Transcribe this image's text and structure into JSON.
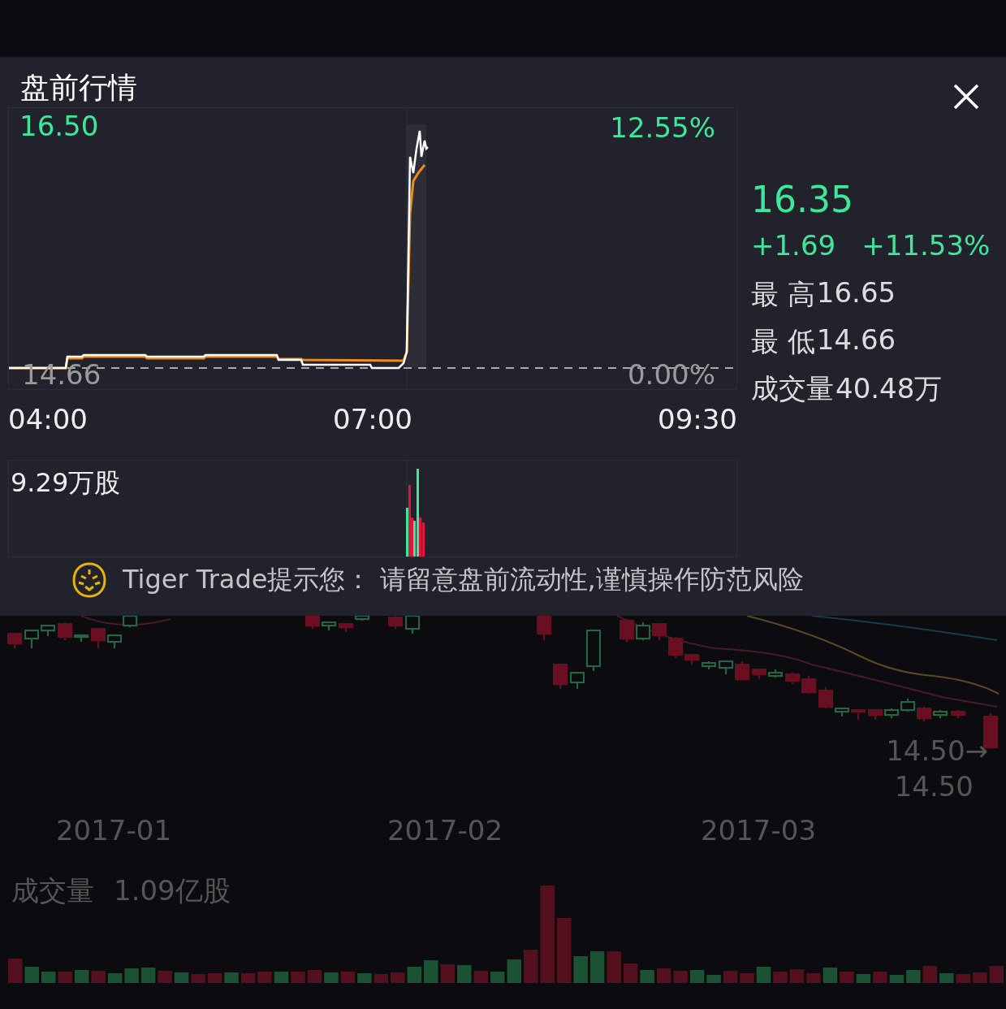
{
  "panel": {
    "title": "盘前行情",
    "chart": {
      "top_price": "16.50",
      "top_percent": "12.55%",
      "base_price": "14.66",
      "base_percent": "0.00%",
      "times": [
        "04:00",
        "07:00",
        "09:30"
      ],
      "volume_label": "9.29万股"
    },
    "quote": {
      "price": "16.35",
      "change": "+1.69",
      "percent": "+11.53%",
      "stats": [
        {
          "label": "最 高",
          "value": "16.65"
        },
        {
          "label": "最 低",
          "value": "14.66"
        },
        {
          "label": "成交量",
          "value": "40.48万"
        }
      ]
    },
    "notice": {
      "text": "Tiger Trade提示您：  请留意盘前流动性,谨慎操作防范风险"
    }
  },
  "background_chart": {
    "price_tags": [
      "14.50→",
      "14.50"
    ],
    "dates": [
      "2017-01",
      "2017-02",
      "2017-03"
    ],
    "volume_title": "成交量",
    "volume_value": "1.09亿股"
  }
}
